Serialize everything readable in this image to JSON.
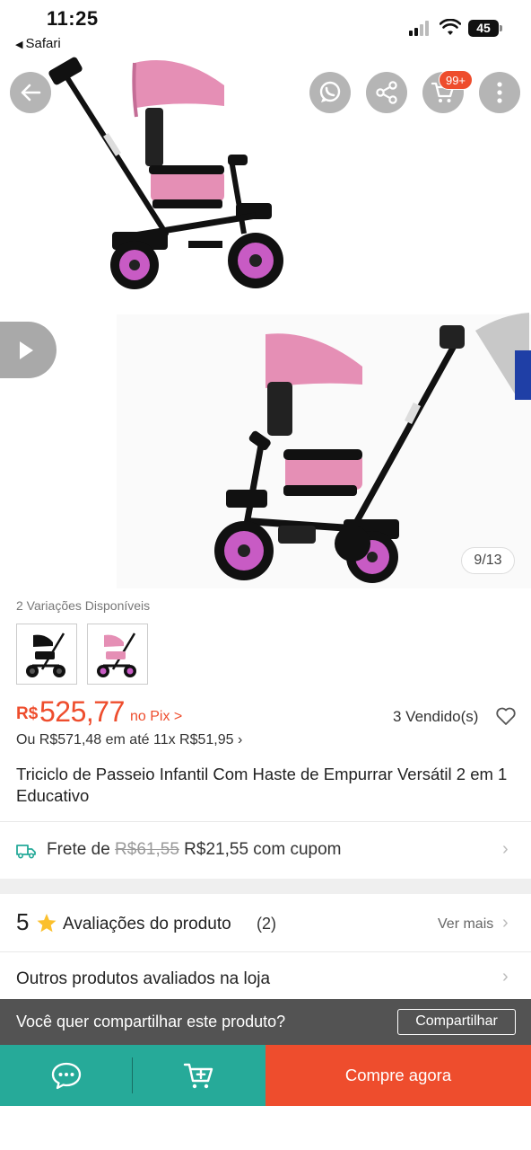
{
  "status_bar": {
    "time": "11:25",
    "back_app": "Safari",
    "battery": "45"
  },
  "gallery": {
    "counter": "9/13",
    "cart_badge": "99+"
  },
  "variations": {
    "label": "2 Variações Disponíveis",
    "count": 2
  },
  "price": {
    "currency": "R$",
    "value": "525,77",
    "pix_label": "no Pix >",
    "sold": "3 Vendido(s)",
    "installments": "Ou R$571,48 em até 11x R$51,95 ›"
  },
  "product": {
    "title": "Triciclo de Passeio Infantil Com Haste de Empurrar Versátil 2 em 1 Educativo"
  },
  "shipping": {
    "prefix": "Frete de",
    "old_price": "R$61,55",
    "new_price": "R$21,55 com cupom"
  },
  "ratings": {
    "score": "5",
    "label": "Avaliações do produto",
    "count": "(2)",
    "see_more": "Ver mais"
  },
  "others": {
    "label": "Outros produtos avaliados na loja"
  },
  "share_banner": {
    "text": "Você quer compartilhar este produto?",
    "button": "Compartilhar"
  },
  "bottom_bar": {
    "buy_label": "Compre agora"
  },
  "colors": {
    "accent": "#ee4d2d",
    "teal": "#26aa99",
    "pink": "#e58fb5",
    "wheel": "#c85bc4"
  },
  "icons": [
    "back-arrow-icon",
    "whatsapp-icon",
    "share-icon",
    "cart-icon",
    "more-icon",
    "play-icon",
    "heart-icon",
    "truck-icon",
    "star-icon",
    "chat-icon",
    "add-to-cart-icon"
  ]
}
